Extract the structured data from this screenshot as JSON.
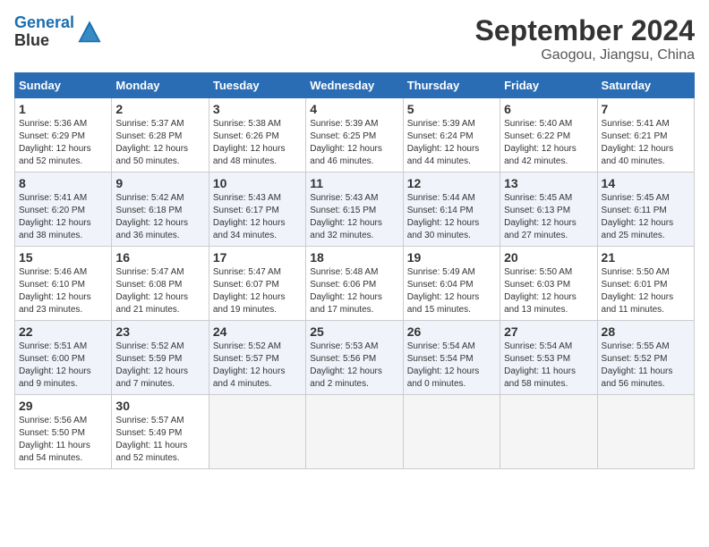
{
  "header": {
    "logo_line1": "General",
    "logo_line2": "Blue",
    "month": "September 2024",
    "location": "Gaogou, Jiangsu, China"
  },
  "days_of_week": [
    "Sunday",
    "Monday",
    "Tuesday",
    "Wednesday",
    "Thursday",
    "Friday",
    "Saturday"
  ],
  "weeks": [
    [
      {
        "day": 1,
        "lines": [
          "Sunrise: 5:36 AM",
          "Sunset: 6:29 PM",
          "Daylight: 12 hours",
          "and 52 minutes."
        ]
      },
      {
        "day": 2,
        "lines": [
          "Sunrise: 5:37 AM",
          "Sunset: 6:28 PM",
          "Daylight: 12 hours",
          "and 50 minutes."
        ]
      },
      {
        "day": 3,
        "lines": [
          "Sunrise: 5:38 AM",
          "Sunset: 6:26 PM",
          "Daylight: 12 hours",
          "and 48 minutes."
        ]
      },
      {
        "day": 4,
        "lines": [
          "Sunrise: 5:39 AM",
          "Sunset: 6:25 PM",
          "Daylight: 12 hours",
          "and 46 minutes."
        ]
      },
      {
        "day": 5,
        "lines": [
          "Sunrise: 5:39 AM",
          "Sunset: 6:24 PM",
          "Daylight: 12 hours",
          "and 44 minutes."
        ]
      },
      {
        "day": 6,
        "lines": [
          "Sunrise: 5:40 AM",
          "Sunset: 6:22 PM",
          "Daylight: 12 hours",
          "and 42 minutes."
        ]
      },
      {
        "day": 7,
        "lines": [
          "Sunrise: 5:41 AM",
          "Sunset: 6:21 PM",
          "Daylight: 12 hours",
          "and 40 minutes."
        ]
      }
    ],
    [
      {
        "day": 8,
        "lines": [
          "Sunrise: 5:41 AM",
          "Sunset: 6:20 PM",
          "Daylight: 12 hours",
          "and 38 minutes."
        ]
      },
      {
        "day": 9,
        "lines": [
          "Sunrise: 5:42 AM",
          "Sunset: 6:18 PM",
          "Daylight: 12 hours",
          "and 36 minutes."
        ]
      },
      {
        "day": 10,
        "lines": [
          "Sunrise: 5:43 AM",
          "Sunset: 6:17 PM",
          "Daylight: 12 hours",
          "and 34 minutes."
        ]
      },
      {
        "day": 11,
        "lines": [
          "Sunrise: 5:43 AM",
          "Sunset: 6:15 PM",
          "Daylight: 12 hours",
          "and 32 minutes."
        ]
      },
      {
        "day": 12,
        "lines": [
          "Sunrise: 5:44 AM",
          "Sunset: 6:14 PM",
          "Daylight: 12 hours",
          "and 30 minutes."
        ]
      },
      {
        "day": 13,
        "lines": [
          "Sunrise: 5:45 AM",
          "Sunset: 6:13 PM",
          "Daylight: 12 hours",
          "and 27 minutes."
        ]
      },
      {
        "day": 14,
        "lines": [
          "Sunrise: 5:45 AM",
          "Sunset: 6:11 PM",
          "Daylight: 12 hours",
          "and 25 minutes."
        ]
      }
    ],
    [
      {
        "day": 15,
        "lines": [
          "Sunrise: 5:46 AM",
          "Sunset: 6:10 PM",
          "Daylight: 12 hours",
          "and 23 minutes."
        ]
      },
      {
        "day": 16,
        "lines": [
          "Sunrise: 5:47 AM",
          "Sunset: 6:08 PM",
          "Daylight: 12 hours",
          "and 21 minutes."
        ]
      },
      {
        "day": 17,
        "lines": [
          "Sunrise: 5:47 AM",
          "Sunset: 6:07 PM",
          "Daylight: 12 hours",
          "and 19 minutes."
        ]
      },
      {
        "day": 18,
        "lines": [
          "Sunrise: 5:48 AM",
          "Sunset: 6:06 PM",
          "Daylight: 12 hours",
          "and 17 minutes."
        ]
      },
      {
        "day": 19,
        "lines": [
          "Sunrise: 5:49 AM",
          "Sunset: 6:04 PM",
          "Daylight: 12 hours",
          "and 15 minutes."
        ]
      },
      {
        "day": 20,
        "lines": [
          "Sunrise: 5:50 AM",
          "Sunset: 6:03 PM",
          "Daylight: 12 hours",
          "and 13 minutes."
        ]
      },
      {
        "day": 21,
        "lines": [
          "Sunrise: 5:50 AM",
          "Sunset: 6:01 PM",
          "Daylight: 12 hours",
          "and 11 minutes."
        ]
      }
    ],
    [
      {
        "day": 22,
        "lines": [
          "Sunrise: 5:51 AM",
          "Sunset: 6:00 PM",
          "Daylight: 12 hours",
          "and 9 minutes."
        ]
      },
      {
        "day": 23,
        "lines": [
          "Sunrise: 5:52 AM",
          "Sunset: 5:59 PM",
          "Daylight: 12 hours",
          "and 7 minutes."
        ]
      },
      {
        "day": 24,
        "lines": [
          "Sunrise: 5:52 AM",
          "Sunset: 5:57 PM",
          "Daylight: 12 hours",
          "and 4 minutes."
        ]
      },
      {
        "day": 25,
        "lines": [
          "Sunrise: 5:53 AM",
          "Sunset: 5:56 PM",
          "Daylight: 12 hours",
          "and 2 minutes."
        ]
      },
      {
        "day": 26,
        "lines": [
          "Sunrise: 5:54 AM",
          "Sunset: 5:54 PM",
          "Daylight: 12 hours",
          "and 0 minutes."
        ]
      },
      {
        "day": 27,
        "lines": [
          "Sunrise: 5:54 AM",
          "Sunset: 5:53 PM",
          "Daylight: 11 hours",
          "and 58 minutes."
        ]
      },
      {
        "day": 28,
        "lines": [
          "Sunrise: 5:55 AM",
          "Sunset: 5:52 PM",
          "Daylight: 11 hours",
          "and 56 minutes."
        ]
      }
    ],
    [
      {
        "day": 29,
        "lines": [
          "Sunrise: 5:56 AM",
          "Sunset: 5:50 PM",
          "Daylight: 11 hours",
          "and 54 minutes."
        ]
      },
      {
        "day": 30,
        "lines": [
          "Sunrise: 5:57 AM",
          "Sunset: 5:49 PM",
          "Daylight: 11 hours",
          "and 52 minutes."
        ]
      },
      null,
      null,
      null,
      null,
      null
    ]
  ]
}
